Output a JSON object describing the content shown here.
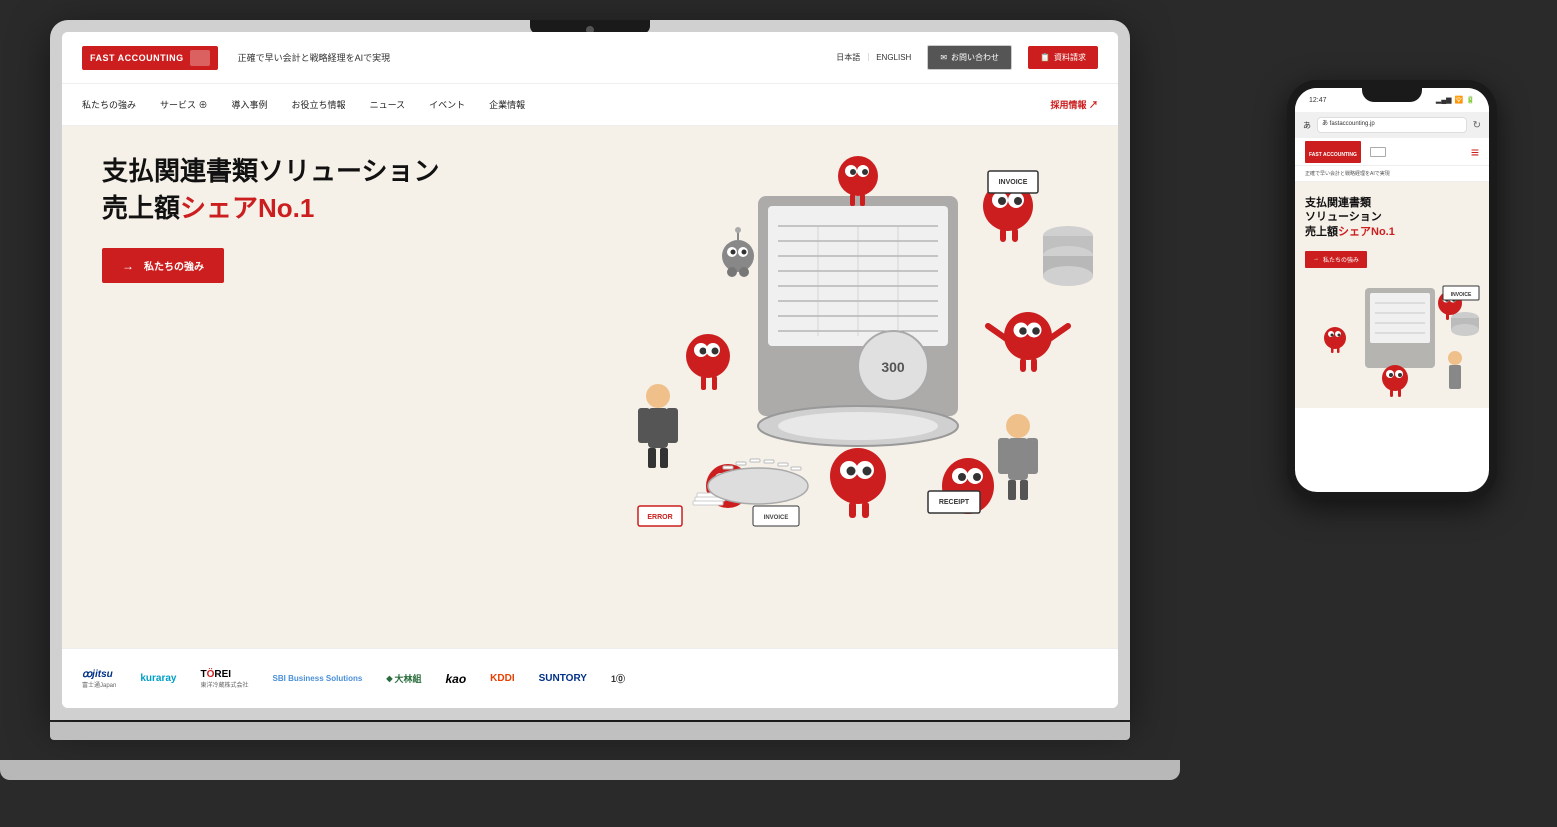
{
  "scene": {
    "bg_color": "#2a2a2a"
  },
  "laptop": {
    "screen": {
      "header": {
        "logo_text": "FAST ACCOUNTING",
        "tagline": "正確で早い会計と戦略経理をAIで実現",
        "lang_ja": "日本語",
        "lang_sep": "｜",
        "lang_en": "ENGLISH",
        "contact_label": "お問い合わせ",
        "request_label": "資料請求"
      },
      "nav": {
        "items": [
          "私たちの強み",
          "サービス ⊕",
          "導入事例",
          "お役立ち情報",
          "ニュース",
          "イベント",
          "企業情報"
        ],
        "cta": "採用情報 ↗"
      },
      "hero": {
        "title1": "支払関連書類ソリューション",
        "title2_plain": "売上額",
        "title2_red": "シェアNo.1",
        "btn_label": "私たちの強み"
      },
      "partners": [
        {
          "name": "FUJITSU",
          "sub": "富士通Japan",
          "style": "fujitsu"
        },
        {
          "name": "kuraray",
          "sub": "",
          "style": "kuraray"
        },
        {
          "name": "TOREI 東洋冷蔵株式会社",
          "sub": "",
          "style": "torei"
        },
        {
          "name": "SBI Business Solutions",
          "sub": "",
          "style": "sbi"
        },
        {
          "name": "大林組",
          "sub": "",
          "style": "obayashi"
        },
        {
          "name": "kao",
          "sub": "",
          "style": "kao"
        },
        {
          "name": "KDDI",
          "sub": "",
          "style": "kddi"
        },
        {
          "name": "SUNTORY",
          "sub": "",
          "style": "suntory"
        }
      ]
    }
  },
  "phone": {
    "status": {
      "time": "12:47",
      "icons": "📶🔋"
    },
    "browser": {
      "url": "あ  fastaccounting.jp"
    },
    "screen": {
      "logo_text": "FAST ACCOUNTING",
      "tagline": "正確で早い会計と戦略経理をAIで実現",
      "menu_icon": "≡",
      "hero_title1": "支払関連書類",
      "hero_title2": "ソリューション",
      "hero_title3_plain": "売上額",
      "hero_title3_red": "シェアNo.1",
      "btn_label": "私たちの強み"
    }
  },
  "colors": {
    "brand_red": "#cc1e1e",
    "dark_header": "#444",
    "hero_bg": "#f5f0e8",
    "white": "#ffffff"
  }
}
